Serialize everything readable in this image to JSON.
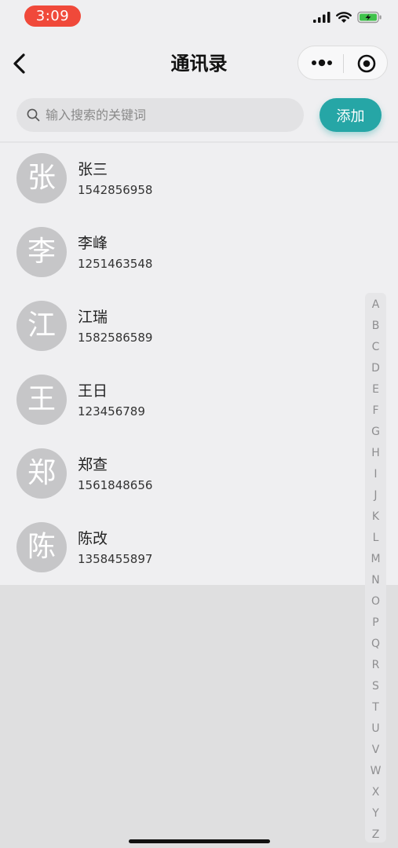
{
  "status_bar": {
    "time": "3:09",
    "time_pill_color": "#f0493a",
    "icons": [
      "signal-icon",
      "wifi-icon",
      "battery-charging-icon"
    ]
  },
  "nav": {
    "title": "通讯录",
    "back_icon": "chevron-left-icon",
    "more_icon": "more-dots-icon",
    "target_icon": "target-icon"
  },
  "search": {
    "placeholder": "输入搜索的关键词",
    "value": "",
    "icon": "search-icon"
  },
  "actions": {
    "add_label": "添加",
    "accent_color": "#26a6a6"
  },
  "contacts": [
    {
      "avatar": "张",
      "name": "张三",
      "phone": "1542856958"
    },
    {
      "avatar": "李",
      "name": "李峰",
      "phone": "1251463548"
    },
    {
      "avatar": "江",
      "name": "江瑞",
      "phone": "1582586589"
    },
    {
      "avatar": "王",
      "name": "王日",
      "phone": "123456789"
    },
    {
      "avatar": "郑",
      "name": "郑查",
      "phone": "1561848656"
    },
    {
      "avatar": "陈",
      "name": "陈改",
      "phone": "1358455897"
    }
  ],
  "alpha_index": [
    "A",
    "B",
    "C",
    "D",
    "E",
    "F",
    "G",
    "H",
    "I",
    "J",
    "K",
    "L",
    "M",
    "N",
    "O",
    "P",
    "Q",
    "R",
    "S",
    "T",
    "U",
    "V",
    "W",
    "X",
    "Y",
    "Z"
  ]
}
